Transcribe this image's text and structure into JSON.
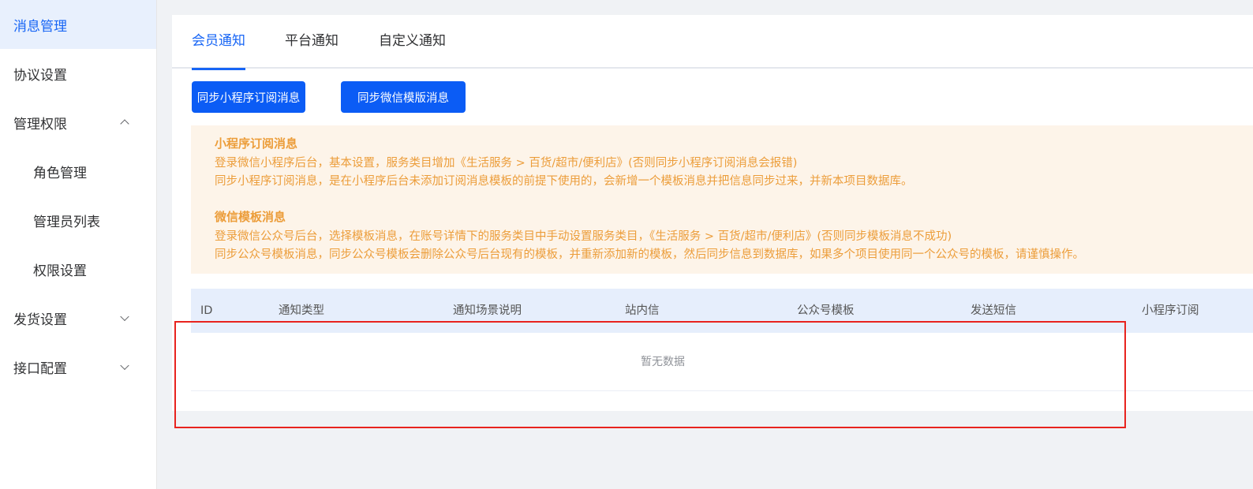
{
  "sidebar": {
    "items": [
      {
        "label": "消息管理"
      },
      {
        "label": "协议设置"
      },
      {
        "label": "管理权限"
      },
      {
        "label": "角色管理"
      },
      {
        "label": "管理员列表"
      },
      {
        "label": "权限设置"
      },
      {
        "label": "发货设置"
      },
      {
        "label": "接口配置"
      }
    ]
  },
  "tabs": [
    "会员通知",
    "平台通知",
    "自定义通知"
  ],
  "buttons": {
    "sync_miniprogram": "同步小程序订阅消息",
    "sync_wechat": "同步微信模版消息"
  },
  "notice": {
    "section1_title": "小程序订阅消息",
    "section1_line1": "登录微信小程序后台，基本设置，服务类目增加《生活服务 > 百货/超市/便利店》(否则同步小程序订阅消息会报错)",
    "section1_line2": "同步小程序订阅消息，是在小程序后台未添加订阅消息模板的前提下使用的，会新增一个模板消息并把信息同步过来，并新本项目数据库。",
    "section2_title": "微信模板消息",
    "section2_line1": "登录微信公众号后台，选择模板消息，在账号详情下的服务类目中手动设置服务类目，《生活服务 > 百货/超市/便利店》(否则同步模板消息不成功)",
    "section2_line2": "同步公众号模板消息，同步公众号模板会删除公众号后台现有的模板，并重新添加新的模板，然后同步信息到数据库，如果多个项目使用同一个公众号的模板，请谨慎操作。"
  },
  "table": {
    "columns": [
      "ID",
      "通知类型",
      "通知场景说明",
      "站内信",
      "公众号模板",
      "发送短信",
      "小程序订阅"
    ],
    "empty_text": "暂无数据"
  },
  "colors": {
    "accent": "#1765f5",
    "button": "#0b5cf5",
    "notice_text": "#ec9d3a",
    "notice_bg": "#fdf4e9",
    "highlight": "#e8231e"
  }
}
